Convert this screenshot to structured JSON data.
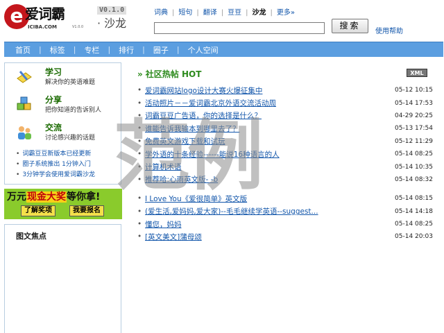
{
  "header": {
    "logo_cn": "爱词霸",
    "logo_en": "ICIBA.COM",
    "logo_sub": "V1.0.0",
    "version": "V0.1.0",
    "section": "· 沙龙"
  },
  "topnav": {
    "items": [
      {
        "label": "词典",
        "active": false
      },
      {
        "label": "短句",
        "active": false
      },
      {
        "label": "翻译",
        "active": false
      },
      {
        "label": "豆豆",
        "active": false
      },
      {
        "label": "沙龙",
        "active": true
      },
      {
        "label": "更多»",
        "active": false
      }
    ]
  },
  "search": {
    "value": "",
    "button_label": "搜索",
    "help_label": "使用帮助"
  },
  "mainnav": [
    "首页",
    "标签",
    "专栏",
    "排行",
    "圈子",
    "个人空间"
  ],
  "sidebar": {
    "features": [
      {
        "title": "学习",
        "desc": "解决你的英语难题",
        "icon": "pencil-notebook-icon"
      },
      {
        "title": "分享",
        "desc": "把你知道的告诉别人",
        "icon": "cubes-icon"
      },
      {
        "title": "交流",
        "desc": "讨论感兴趣的话题",
        "icon": "people-icon"
      }
    ],
    "links": [
      "词霸豆豆新版本已经更新",
      "圈子系统推出 1分钟入门",
      "3分钟学会使用爱词霸沙龙"
    ]
  },
  "banner": {
    "text_a": "万元",
    "text_highlight": "现金大奖",
    "text_b": "等你拿!",
    "btn1": "了解奖项",
    "btn2": "我要报名"
  },
  "leftbox2": {
    "title": "图文焦点"
  },
  "main": {
    "heading": "社区热帖 HOT",
    "xml_label": "XML",
    "topics": [
      {
        "title": "爱词霸网站logo设计大赛火爆征集中",
        "date": "05-12 10:15"
      },
      {
        "title": "活动照片－－爱词霸北京外语交流活动周",
        "date": "05-14 17:53"
      },
      {
        "title": "词霸豆豆广告语，你的选择是什么？",
        "date": "04-29 20:25"
      },
      {
        "title": "谁能告诉我输本到哪里去了？",
        "date": "05-13 17:54"
      },
      {
        "title": "免费英文游戏下载和试玩",
        "date": "05-12 11:29"
      },
      {
        "title": "学外语的十条经验------能说16种语言的人",
        "date": "05-14 08:25"
      },
      {
        "title": "计算机术语",
        "date": "05-14 10:35"
      },
      {
        "title": "推荐哈:心雨英文版- -b",
        "date": "05-14 08:32"
      },
      {
        "title": "I Love You《爱很简单》英文版",
        "date": "05-14 08:15"
      },
      {
        "title": "(爱生活,爱妈妈,爱大家)--毛毛继续学英语--suggest...",
        "date": "05-14 14:18"
      },
      {
        "title": "懂您，妈妈",
        "date": "05-14 08:25"
      },
      {
        "title": "[英文美文]蒲母颂",
        "date": "05-14 20:03"
      }
    ]
  },
  "watermark": "范例"
}
